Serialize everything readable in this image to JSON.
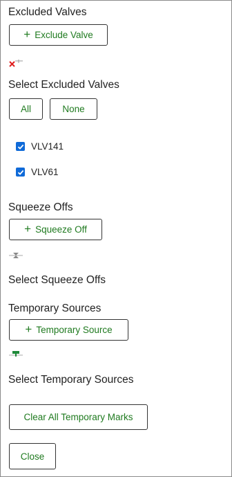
{
  "excluded_valves": {
    "heading": "Excluded Valves",
    "add_button": "Exclude Valve",
    "select_heading": "Select Excluded Valves",
    "all_button": "All",
    "none_button": "None",
    "items": [
      {
        "label": "VLV141",
        "checked": true
      },
      {
        "label": "VLV61",
        "checked": true
      }
    ]
  },
  "squeeze_offs": {
    "heading": "Squeeze Offs",
    "add_button": "Squeeze Off",
    "select_heading": "Select Squeeze Offs"
  },
  "temporary_sources": {
    "heading": "Temporary Sources",
    "add_button": "Temporary Source",
    "select_heading": "Select Temporary Sources"
  },
  "actions": {
    "clear_all": "Clear All Temporary Marks",
    "close": "Close"
  },
  "colors": {
    "accent_text": "#1f7a1f",
    "checkbox": "#0f6ad8",
    "valve_marker": "#e02020"
  },
  "icons": {
    "add": "plus-icon",
    "valve_marker": "excluded-valve-marker-icon",
    "squeeze_marker": "squeeze-off-marker-icon",
    "source_marker": "temporary-source-marker-icon"
  }
}
